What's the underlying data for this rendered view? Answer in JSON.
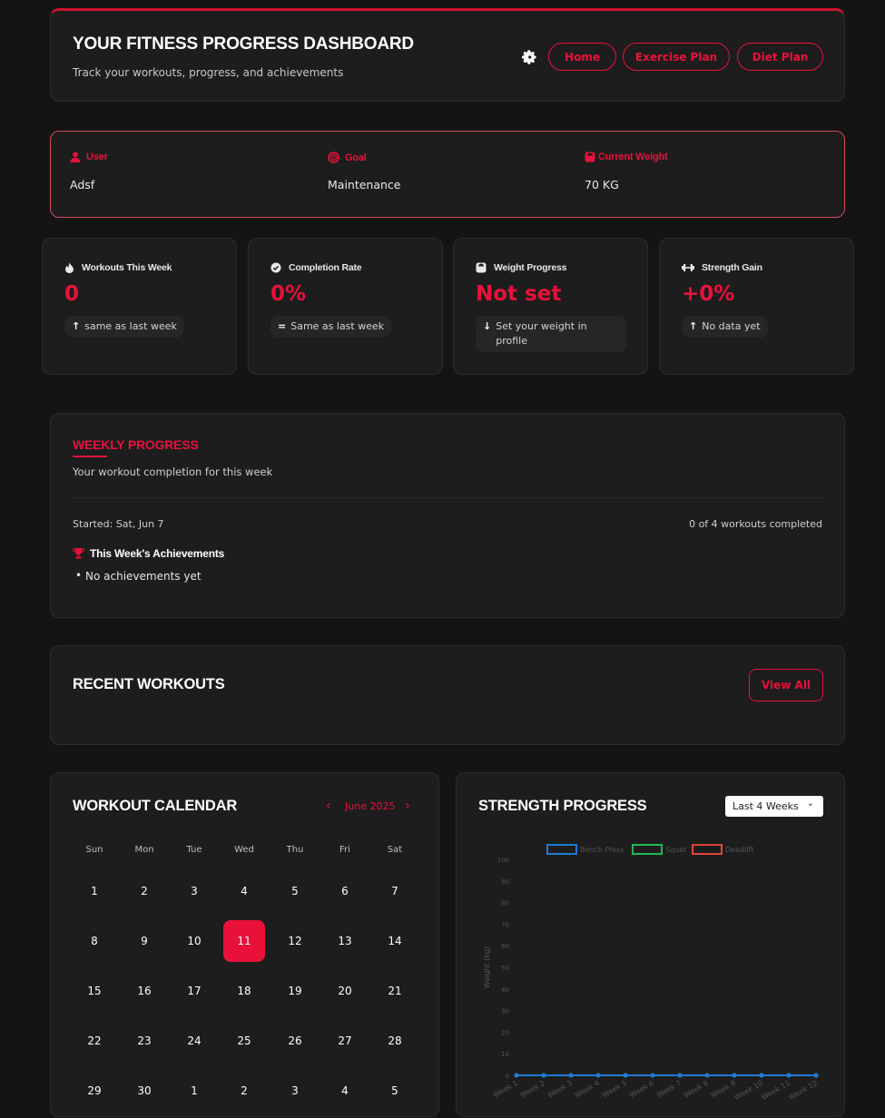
{
  "header": {
    "title": "YOUR FITNESS PROGRESS DASHBOARD",
    "subtitle": "Track your workouts, progress, and achievements",
    "nav": [
      "Home",
      "Exercise Plan",
      "Diet Plan"
    ]
  },
  "profile": {
    "user_label": "User",
    "user_value": "Adsf",
    "goal_label": "Goal",
    "goal_value": "Maintenance",
    "weight_label": "Current Weight",
    "weight_value": "70 KG"
  },
  "stats": [
    {
      "label": "Workouts This Week",
      "value": "0",
      "note": "same as last week",
      "icon": "fire-icon",
      "trend": "up-arrow-icon"
    },
    {
      "label": "Completion Rate",
      "value": "0%",
      "note": "Same as last week",
      "icon": "check-circle-icon",
      "trend": "equals-icon"
    },
    {
      "label": "Weight Progress",
      "value": "Not set",
      "note": "Set your weight in profile",
      "icon": "weight-icon",
      "trend": "down-arrow-icon"
    },
    {
      "label": "Strength Gain",
      "value": "+0%",
      "note": "No data yet",
      "icon": "dumbbell-icon",
      "trend": "up-arrow-icon"
    }
  ],
  "weekly": {
    "title": "WEEKLY PROGRESS",
    "subtitle": "Your workout completion for this week",
    "started": "Started: Sat, Jun 7",
    "completed": "0 of 4 workouts completed",
    "achievements_title": "This Week's Achievements",
    "achievement_items": [
      "No achievements yet"
    ]
  },
  "recent": {
    "title": "RECENT WORKOUTS",
    "view_all": "View All"
  },
  "calendar": {
    "title": "WORKOUT CALENDAR",
    "month": "June 2025",
    "prev": "‹",
    "next": "›",
    "weekdays": [
      "Sun",
      "Mon",
      "Tue",
      "Wed",
      "Thu",
      "Fri",
      "Sat"
    ],
    "days": [
      [
        "1",
        "2",
        "3",
        "4",
        "5",
        "6",
        "7"
      ],
      [
        "8",
        "9",
        "10",
        "11",
        "12",
        "13",
        "14"
      ],
      [
        "15",
        "16",
        "17",
        "18",
        "19",
        "20",
        "21"
      ],
      [
        "22",
        "23",
        "24",
        "25",
        "26",
        "27",
        "28"
      ],
      [
        "29",
        "30",
        "1",
        "2",
        "3",
        "4",
        "5"
      ]
    ],
    "today": "11"
  },
  "strength": {
    "title": "STRENGTH PROGRESS",
    "range": "Last 4 Weeks"
  },
  "colors": {
    "accent": "#e8113a",
    "background": "#141414",
    "card": "#1d1d1d"
  },
  "chart_data": {
    "type": "line",
    "x": [
      "Week 1",
      "Week 2",
      "Week 3",
      "Week 4",
      "Week 5",
      "Week 6",
      "Week 7",
      "Week 8",
      "Week 9",
      "Week 10",
      "Week 11",
      "Week 12"
    ],
    "series": [
      {
        "name": "Bench Press",
        "color": "#1e7bd6",
        "values": [
          0,
          0,
          0,
          0,
          0,
          0,
          0,
          0,
          0,
          0,
          0,
          0
        ]
      },
      {
        "name": "Squat",
        "color": "#1db954",
        "values": [
          0,
          0,
          0,
          0,
          0,
          0,
          0,
          0,
          0,
          0,
          0,
          0
        ]
      },
      {
        "name": "Deadlift",
        "color": "#e0453a",
        "values": [
          0,
          0,
          0,
          0,
          0,
          0,
          0,
          0,
          0,
          0,
          0,
          0
        ]
      }
    ],
    "ylabel": "Weight (kg)",
    "yticks": [
      0,
      10,
      20,
      30,
      40,
      50,
      60,
      70,
      80,
      90,
      100
    ],
    "ylim": [
      0,
      100
    ],
    "legend": "top"
  }
}
